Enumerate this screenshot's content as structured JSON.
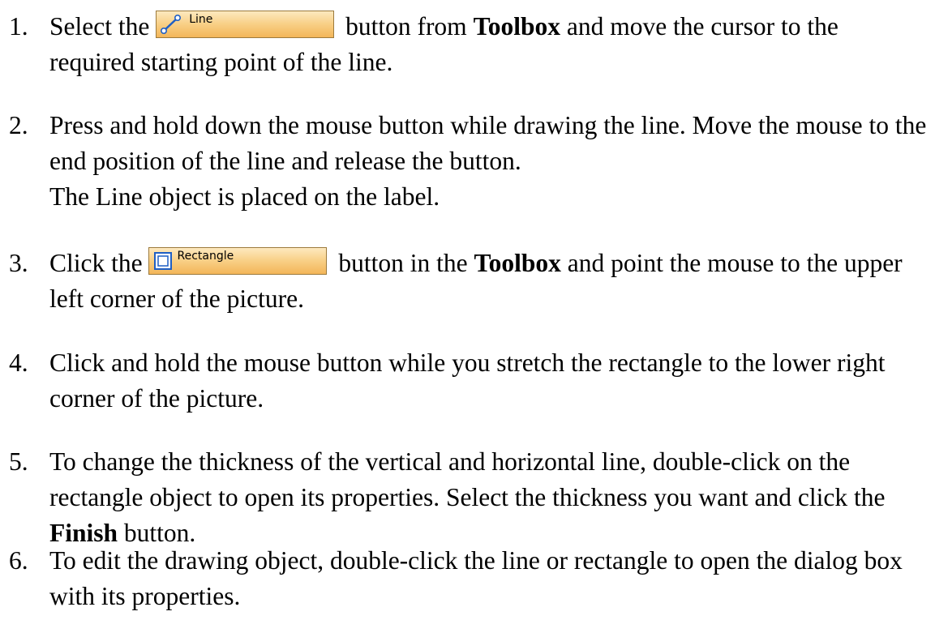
{
  "steps": [
    {
      "number": "1.",
      "before_button": "Select the ",
      "button": {
        "label": "Line",
        "icon": "line-tool-icon"
      },
      "after_button": " button from ",
      "bold": "Toolbox",
      "rest": " and move the cursor to the required starting point of the line."
    },
    {
      "number": "2.",
      "text": "Press and hold down the mouse button while drawing the line. Move the mouse to the end position of the line and release the button.",
      "note": "The Line object is placed on the label."
    },
    {
      "number": "3.",
      "before_button": "Click the ",
      "button": {
        "label": "Rectangle",
        "icon": "rectangle-tool-icon"
      },
      "after_button": " button in the ",
      "bold": "Toolbox",
      "rest": " and point the mouse to the upper left corner of the picture."
    },
    {
      "number": "4.",
      "text": "Click and hold the mouse button while you stretch the rectangle to the lower right corner of the picture."
    },
    {
      "number": "5.",
      "before_bold": "To change the thickness of the vertical and horizontal line, double-click on the rectangle object to open its properties. Select the thickness you want and click the ",
      "bold": "Finish",
      "rest": " button."
    },
    {
      "number": "6.",
      "text": "To edit the drawing object, double-click the line or rectangle to open the dialog box with its properties."
    }
  ],
  "colors": {
    "button_gradient_top": "#fde9bf",
    "button_gradient_bottom": "#f3b659",
    "button_border": "#9c7a3c",
    "icon_blue": "#1f5fc4"
  }
}
